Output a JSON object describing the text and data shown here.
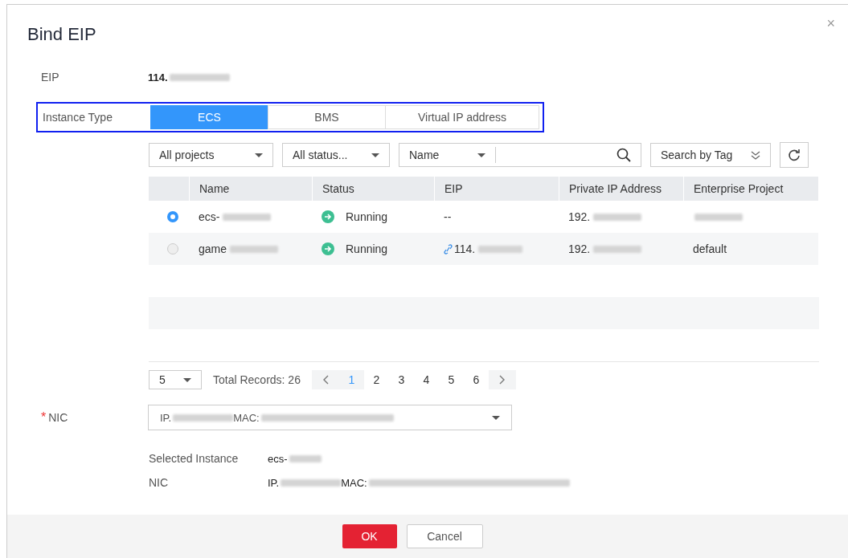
{
  "dialog": {
    "title": "Bind EIP",
    "close": "×"
  },
  "eip": {
    "label": "EIP",
    "value": {
      "text": "114.",
      "redacted": true
    }
  },
  "instance_type": {
    "label": "Instance Type",
    "tabs": [
      {
        "label": "ECS",
        "selected": true
      },
      {
        "label": "BMS",
        "selected": false
      },
      {
        "label": "Virtual IP address",
        "selected": false
      }
    ]
  },
  "filters": {
    "project": "All projects",
    "status": "All status...",
    "search_by": "Name",
    "tag_search": "Search by Tag"
  },
  "table": {
    "columns": [
      "Name",
      "Status",
      "EIP",
      "Private IP Address",
      "Enterprise Project"
    ],
    "rows": [
      {
        "selected": true,
        "name": {
          "text": "ecs-",
          "redacted": true
        },
        "status": "Running",
        "eip": {
          "text": "--",
          "redacted": false,
          "linked": false
        },
        "private_ip": {
          "text": "192.",
          "redacted": true
        },
        "project": {
          "redacted": true
        }
      },
      {
        "selected": false,
        "name": {
          "text": "game",
          "redacted": true
        },
        "status": "Running",
        "eip": {
          "text": "114.",
          "redacted": true,
          "linked": true
        },
        "private_ip": {
          "text": "192.",
          "redacted": true
        },
        "project": {
          "text": "default",
          "redacted": false
        }
      }
    ]
  },
  "pagination": {
    "page_size": "5",
    "total": "Total Records: 26",
    "pages": [
      {
        "label": "1",
        "selected": true
      },
      {
        "label": "2",
        "selected": false
      },
      {
        "label": "3",
        "selected": false
      },
      {
        "label": "4",
        "selected": false
      },
      {
        "label": "5",
        "selected": false
      },
      {
        "label": "6",
        "selected": false
      }
    ]
  },
  "nic": {
    "label": "NIC",
    "required_mark": "*",
    "value": [
      {
        "text": "IP.",
        "redacted": true
      },
      {
        "text": "MAC:",
        "redacted": true
      }
    ]
  },
  "summary": [
    {
      "label": "Selected Instance",
      "value": [
        {
          "text": "ecs-",
          "redacted": true
        }
      ]
    },
    {
      "label": "NIC",
      "value": [
        {
          "text": "IP.",
          "redacted": true
        },
        {
          "text": "MAC:",
          "redacted": true
        }
      ]
    }
  ],
  "buttons": {
    "ok": "OK",
    "cancel": "Cancel"
  }
}
